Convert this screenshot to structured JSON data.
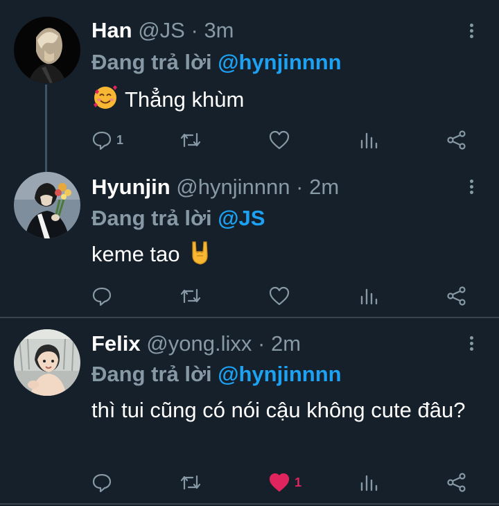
{
  "reply_prefix": "Đang trả lời",
  "tweets": [
    {
      "name": "Han",
      "handle": "@JS",
      "dot": "·",
      "time": "3m",
      "replying_to": "@hynjinnnn",
      "text": "Thẳng khùm",
      "leading_emoji": "smiling-face-with-hearts",
      "replies": "1",
      "likes": "",
      "liked": false
    },
    {
      "name": "Hyunjin",
      "handle": "@hynjinnnn",
      "dot": "·",
      "time": "2m",
      "replying_to": "@JS",
      "text": "keme tao",
      "trailing_emoji": "sign-of-the-horns",
      "replies": "",
      "likes": "",
      "liked": false
    },
    {
      "name": "Felix",
      "handle": "@yong.lixx",
      "dot": "·",
      "time": "2m",
      "replying_to": "@hynjinnnn",
      "text": "thì tui cũng có nói cậu không cute đâu?",
      "replies": "",
      "likes": "1",
      "liked": true
    }
  ],
  "colors": {
    "background": "#15202b",
    "text": "#ffffff",
    "muted": "#8899a6",
    "mention": "#1da1f2",
    "like": "#e0245e",
    "divider": "#38444d"
  },
  "icons": [
    "reply-icon",
    "retweet-icon",
    "like-icon",
    "analytics-icon",
    "share-icon",
    "more-icon"
  ]
}
